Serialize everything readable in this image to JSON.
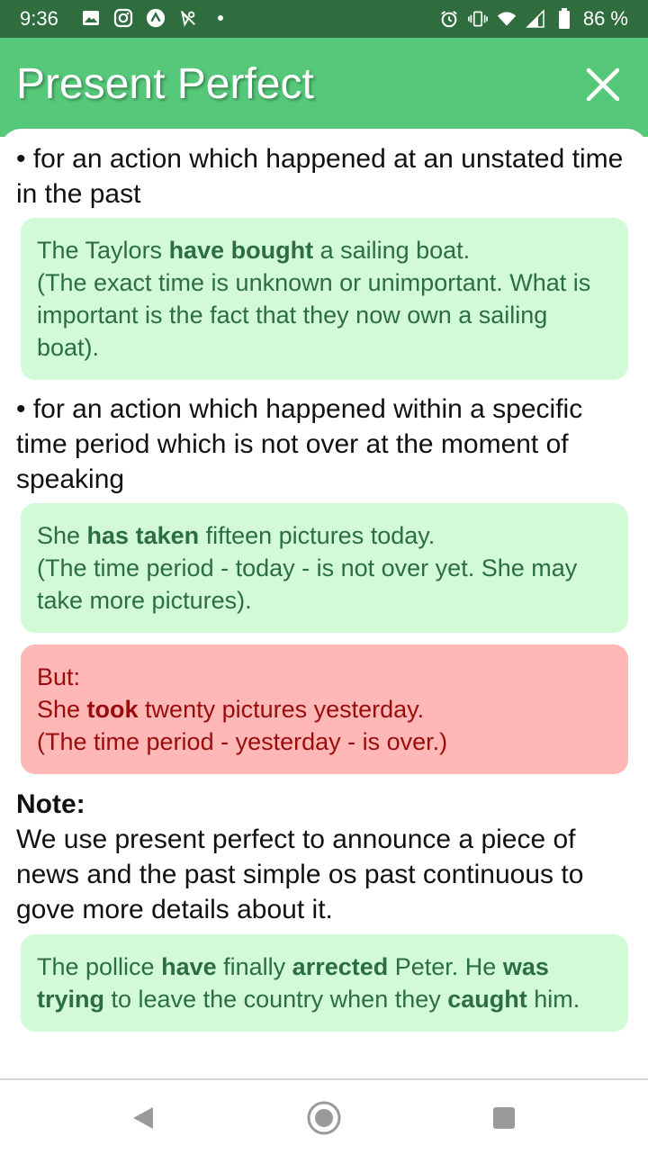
{
  "status_bar": {
    "time": "9:36",
    "battery": "86 %",
    "left_icons": [
      "image-icon",
      "instagram-icon",
      "app-icon",
      "location-off-icon",
      "dot-icon"
    ],
    "right_icons": [
      "alarm-icon",
      "vibrate-icon",
      "wifi-icon",
      "signal-icon",
      "battery-icon"
    ]
  },
  "header": {
    "title": "Present Perfect",
    "close_icon": "close-icon",
    "color": "#55c979"
  },
  "content": {
    "bullet1": "• for an action which happened at an unstated time in the past",
    "example1": {
      "pre": "The Taylors ",
      "bold": "have bought",
      "post": " a sailing boat.",
      "line2": "(The exact time is unknown or unimportant. What is important is the fact that they now own a sailing boat)."
    },
    "bullet2": "• for an action which happened within a specific time period which is not over at the moment of speaking",
    "example2": {
      "pre": "She ",
      "bold": "has taken",
      "post": " fifteen pictures today.",
      "line2": "(The time period - today - is not over yet. She may take more pictures)."
    },
    "counter_example": {
      "label": "But:",
      "pre": "She ",
      "bold": "took",
      "post": " twenty pictures yesterday.",
      "line2": "(The time period - yesterday - is over.)"
    },
    "note_label": "Note:",
    "note_text": "We use present perfect to announce a piece of news and the past simple os past continuous to gove more details about it.",
    "example3": {
      "p1": "The pollice ",
      "b1": "have",
      "p2": " finally ",
      "b2": "arrected",
      "p3": " Peter. He ",
      "b3": "was trying",
      "p4": " to leave the country when they ",
      "b4": "caught",
      "p5": " him."
    }
  },
  "nav_bar": {
    "buttons": [
      "back-icon",
      "home-icon",
      "recents-icon"
    ]
  }
}
